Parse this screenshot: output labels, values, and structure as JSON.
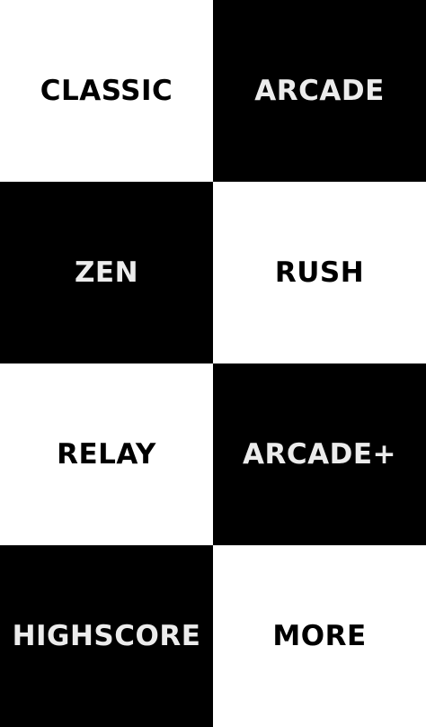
{
  "menu": {
    "tiles": [
      {
        "label": "CLASSIC",
        "theme": "light"
      },
      {
        "label": "ARCADE",
        "theme": "dark"
      },
      {
        "label": "ZEN",
        "theme": "dark"
      },
      {
        "label": "RUSH",
        "theme": "light"
      },
      {
        "label": "RELAY",
        "theme": "light"
      },
      {
        "label": "ARCADE+",
        "theme": "dark"
      },
      {
        "label": "HIGHSCORE",
        "theme": "dark"
      },
      {
        "label": "MORE",
        "theme": "light"
      }
    ]
  },
  "colors": {
    "light_tile": "#ffffff",
    "dark_tile": "#000000",
    "light_text": "#000000",
    "dark_text": "#ececec"
  }
}
